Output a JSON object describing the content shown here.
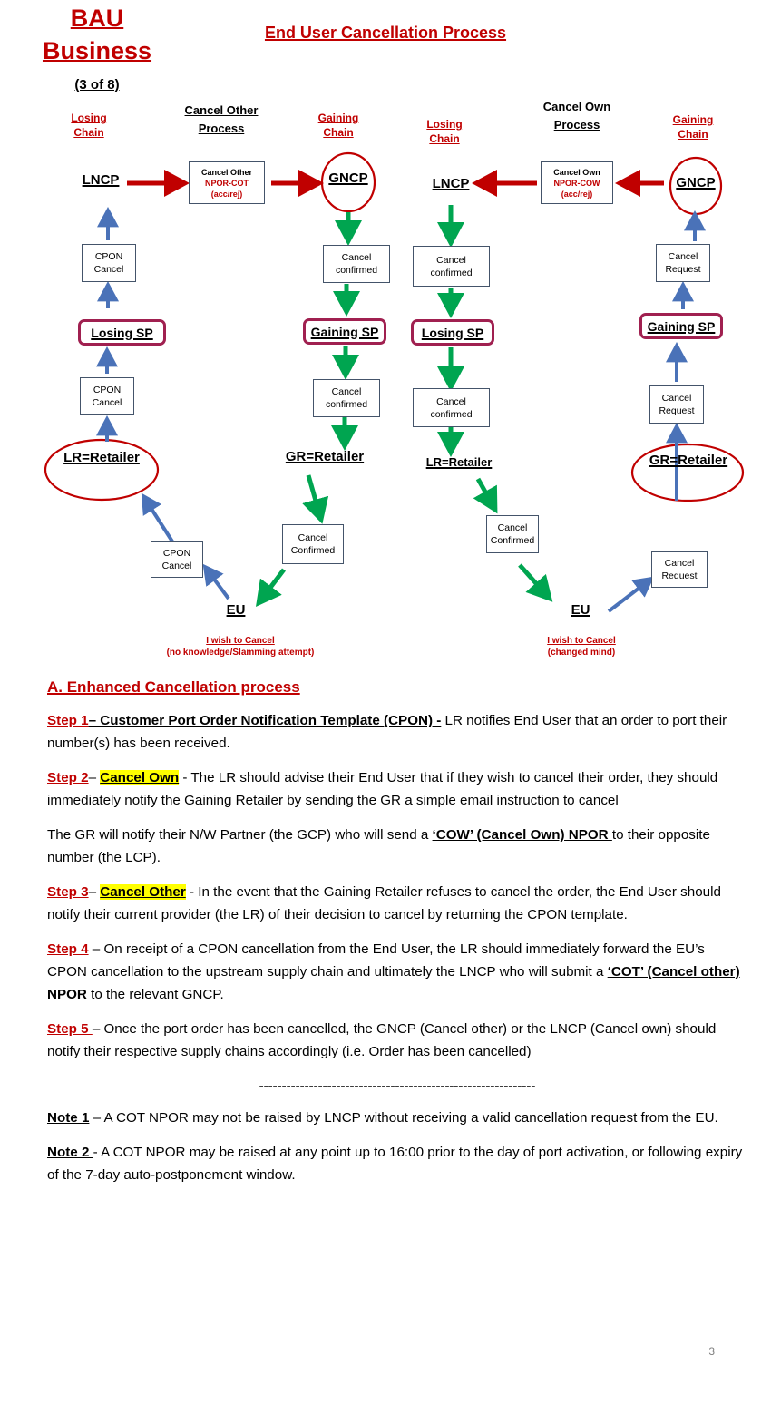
{
  "header": {
    "bau_title_line1": "BAU",
    "bau_title_line2": "Business",
    "bau_subtitle": "(3 of 8)",
    "main_title": "End User Cancellation Process"
  },
  "diagram": {
    "process_captions": {
      "cancel_other": "Cancel Other\nProcess",
      "cancel_own": "Cancel Own\nProcess"
    },
    "chain_captions": {
      "losing_left": "Losing\nChain",
      "gaining_left": "Gaining\nChain",
      "losing_right": "Losing\nChain",
      "gaining_right": "Gaining\nChain"
    },
    "nodes": {
      "lncp_left": "LNCP",
      "gncp_left": "GNCP",
      "lncp_right": "LNCP",
      "gncp_right": "GNCP",
      "losing_sp_col1": "Losing SP",
      "gaining_sp_col2": "Gaining SP",
      "losing_sp_col3": "Losing SP",
      "gaining_sp_col4": "Gaining SP",
      "lr_retailer_col1": "LR=Retailer",
      "gr_retailer_col2": "GR=Retailer",
      "lr_retailer_col3": "LR=Retailer",
      "gr_retailer_col4": "GR=Retailer",
      "eu_left": "EU",
      "eu_right": "EU"
    },
    "npor_boxes": {
      "cancel_other": {
        "line1": "Cancel Other",
        "line2": "NPOR-COT",
        "line3": "(acc/rej)"
      },
      "cancel_own": {
        "line1": "Cancel Own",
        "line2": "NPOR-COW",
        "line3": "(acc/rej)"
      }
    },
    "message_boxes": {
      "cpon_cancel": "CPON\nCancel",
      "cancel_confirmed_lower": "Cancel\nconfirmed",
      "cancel_request": "Cancel\nRequest",
      "cancel_confirmed_cap": "Cancel\nConfirmed"
    },
    "eu_notes": {
      "left_line1": "I wish to Cancel",
      "left_line2": "(no knowledge/Slamming attempt)",
      "right_line1": "I wish to Cancel",
      "right_line2": "(changed mind)"
    }
  },
  "prose": {
    "section_heading": "A. Enhanced Cancellation process",
    "step1_label": "Step 1",
    "step1_bold": "– Customer Port Order Notification Template (CPON) -",
    "step1_text": " LR notifies End User that an order to port their number(s) has been received.",
    "step2_label": "Step 2",
    "step2_dash": "– ",
    "step2_hl": "Cancel Own",
    "step2_text": " - The LR should advise their End User that if they wish to cancel their order, they should immediately notify the Gaining Retailer by sending the GR a simple email instruction to cancel",
    "para_gr_pre": "The GR will notify their N/W Partner (the GCP) who will send a ",
    "para_gr_bold": "‘COW’ (Cancel Own) NPOR ",
    "para_gr_post": "to their opposite number (the LCP).",
    "step3_label": "Step 3",
    "step3_dash": "– ",
    "step3_hl": "Cancel Other",
    "step3_text": " -  In the event that the Gaining Retailer refuses to cancel the order, the End User should notify their current provider (the LR) of their decision to cancel by returning the CPON template.",
    "step4_label": "Step 4",
    "step4_pre": " – On receipt of a CPON cancellation from the End User, the LR should immediately forward the EU’s CPON cancellation to the upstream supply chain and ultimately the LNCP who will submit a ",
    "step4_bold": "‘COT’ (Cancel other) NPOR ",
    "step4_post": "to the relevant GNCP.",
    "step5_label": "Step 5 ",
    "step5_text": "– Once the port order has been cancelled, the GNCP (Cancel other) or the LNCP (Cancel own) should notify their respective supply chains accordingly (i.e. Order has been cancelled)",
    "divider": "-------------------------------------------------------------",
    "note1_label": "Note 1",
    "note1_text": " – A COT NPOR may not be raised by LNCP without receiving a valid cancellation request from the EU.",
    "note2_label": "Note 2 ",
    "note2_text": "- A COT NPOR may be raised at any point up to 16:00 prior to the day of port activation, or following expiry of the 7-day auto-postponement window."
  },
  "footer": {
    "page_number": "3"
  },
  "colors": {
    "red": "#C00000",
    "maroon": "#A02050",
    "green": "#00A550",
    "blue": "#4A72B8",
    "box_border": "#44546A",
    "highlight": "#FFFF00"
  }
}
